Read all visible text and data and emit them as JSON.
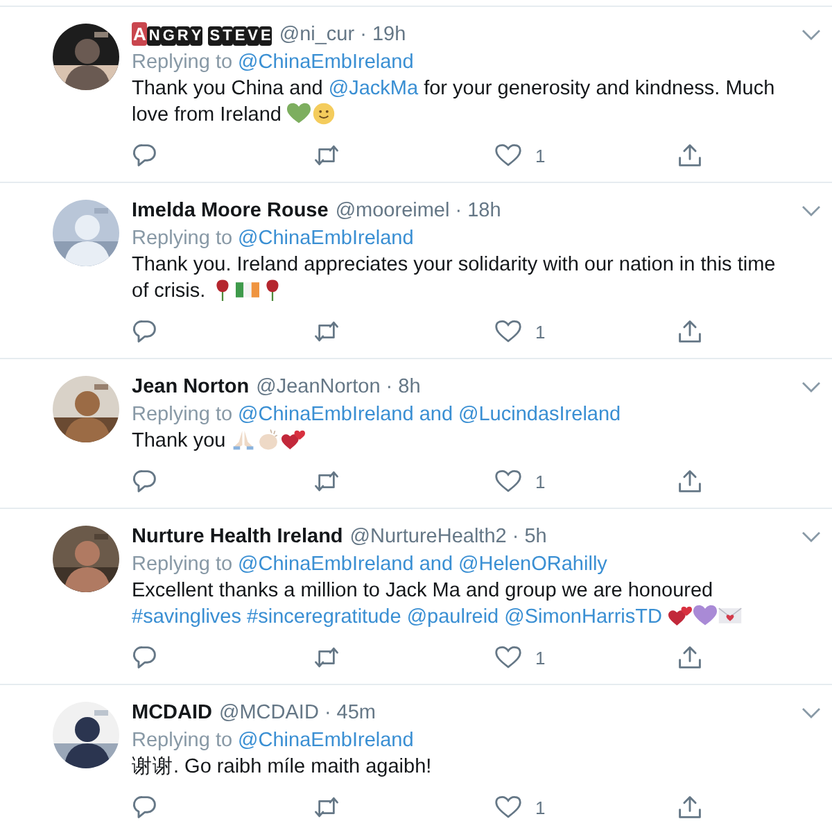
{
  "tweets": [
    {
      "avatar": {
        "kind": "picture"
      },
      "name": {
        "kind": "boxed",
        "text": "ANGRY STEVE"
      },
      "handle": "@ni_cur",
      "separator": "·",
      "time": "19h",
      "replying_label": "Replying to",
      "replying_to": [
        {
          "handle": "@ChinaEmbIreland"
        }
      ],
      "body": [
        {
          "kind": "text",
          "text": "Thank you China and "
        },
        {
          "kind": "link",
          "text": "@JackMa"
        },
        {
          "kind": "text",
          "text": " for your generosity and kindness. Much love from Ireland "
        },
        {
          "kind": "heart",
          "color": "#7dae5f"
        },
        {
          "kind": "smiley"
        }
      ],
      "likes": "1"
    },
    {
      "avatar": {
        "kind": "picture"
      },
      "name": {
        "kind": "plain",
        "text": "Imelda Moore Rouse"
      },
      "handle": "@mooreimel",
      "separator": "·",
      "time": "18h",
      "replying_label": "Replying to",
      "replying_to": [
        {
          "handle": "@ChinaEmbIreland"
        }
      ],
      "body": [
        {
          "kind": "text",
          "text": "Thank you. Ireland appreciates your solidarity with our nation in this time of crisis. "
        },
        {
          "kind": "rose"
        },
        {
          "kind": "flag"
        },
        {
          "kind": "rose"
        }
      ],
      "likes": "1"
    },
    {
      "avatar": {
        "kind": "picture"
      },
      "name": {
        "kind": "plain",
        "text": "Jean Norton"
      },
      "handle": "@JeanNorton",
      "separator": "·",
      "time": "8h",
      "replying_label": "Replying to",
      "replying_to": [
        {
          "handle": "@ChinaEmbIreland"
        },
        {
          "joiner": "and",
          "handle": "@LucindasIreland"
        }
      ],
      "body": [
        {
          "kind": "text",
          "text": "Thank you "
        },
        {
          "kind": "pray"
        },
        {
          "kind": "clap"
        },
        {
          "kind": "hearts"
        }
      ],
      "likes": "1"
    },
    {
      "avatar": {
        "kind": "picture"
      },
      "name": {
        "kind": "plain",
        "text": "Nurture Health Ireland"
      },
      "handle": "@NurtureHealth2",
      "separator": "·",
      "time": "5h",
      "replying_label": "Replying to",
      "replying_to": [
        {
          "handle": "@ChinaEmbIreland"
        },
        {
          "joiner": "and",
          "handle": "@HelenORahilly"
        }
      ],
      "body": [
        {
          "kind": "text",
          "text": "Excellent thanks a million to Jack Ma and group we are honoured "
        },
        {
          "kind": "link",
          "text": "#savinglives"
        },
        {
          "kind": "space"
        },
        {
          "kind": "link",
          "text": "#sinceregratitude"
        },
        {
          "kind": "space"
        },
        {
          "kind": "link",
          "text": "@paulreid"
        },
        {
          "kind": "space"
        },
        {
          "kind": "link",
          "text": "@SimonHarrisTD"
        },
        {
          "kind": "space"
        },
        {
          "kind": "hearts"
        },
        {
          "kind": "heart",
          "color": "#a98ad6"
        },
        {
          "kind": "envelope"
        }
      ],
      "likes": "1"
    },
    {
      "avatar": {
        "kind": "picture"
      },
      "name": {
        "kind": "plain",
        "text": "MCDAID"
      },
      "handle": "@MCDAID",
      "separator": "·",
      "time": "45m",
      "replying_label": "Replying to",
      "replying_to": [
        {
          "handle": "@ChinaEmbIreland"
        }
      ],
      "body": [
        {
          "kind": "text",
          "text": "谢谢. Go raibh míle maith agaibh!"
        }
      ],
      "likes": "1"
    }
  ]
}
